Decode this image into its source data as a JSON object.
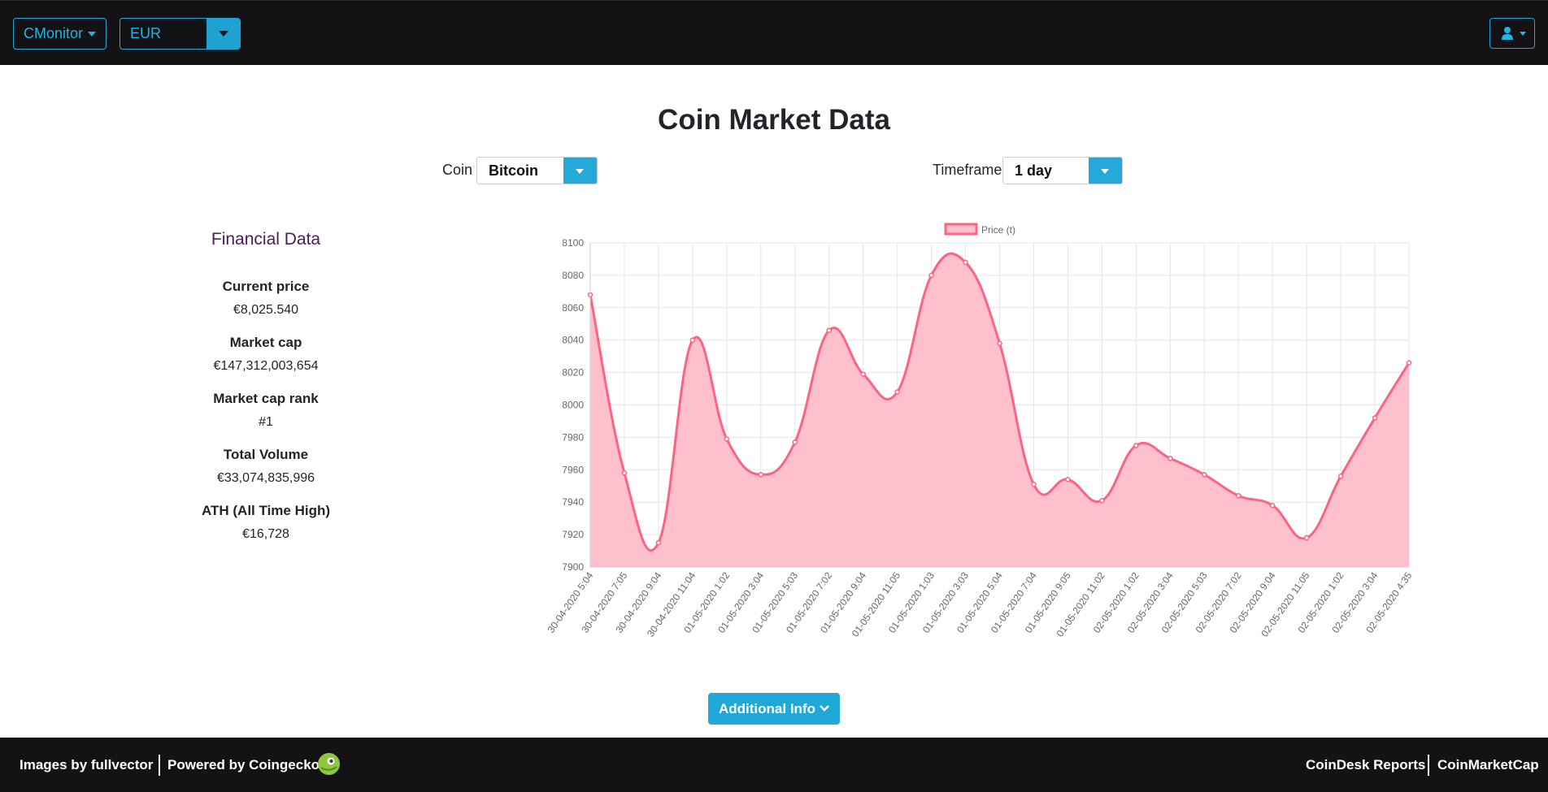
{
  "nav": {
    "brand_label": "CMonitor",
    "currency": "EUR"
  },
  "page": {
    "title": "Coin Market Data"
  },
  "controls": {
    "coin_label": "Coin",
    "coin_value": "Bitcoin",
    "timeframe_label": "Timeframe",
    "timeframe_value": "1 day"
  },
  "financial": {
    "title": "Financial Data",
    "items": [
      {
        "label": "Current price",
        "value": "€8,025.540"
      },
      {
        "label": "Market cap",
        "value": "€147,312,003,654"
      },
      {
        "label": "Market cap rank",
        "value": "#1"
      },
      {
        "label": "Total Volume",
        "value": "€33,074,835,996"
      },
      {
        "label": "ATH (All Time High)",
        "value": "€16,728"
      }
    ]
  },
  "chart_data": {
    "type": "area",
    "legend": "Price (t)",
    "legend_position": "top",
    "series": [
      {
        "name": "Price (t)",
        "color": "#ff6384",
        "fill": "#ffc0cd"
      }
    ],
    "categories": [
      "30-04-2020 5:04",
      "30-04-2020 7:05",
      "30-04-2020 9:04",
      "30-04-2020 11:04",
      "01-05-2020 1:02",
      "01-05-2020 3:04",
      "01-05-2020 5:03",
      "01-05-2020 7:02",
      "01-05-2020 9:04",
      "01-05-2020 11:05",
      "01-05-2020 1:03",
      "01-05-2020 3:03",
      "01-05-2020 5:04",
      "01-05-2020 7:04",
      "01-05-2020 9:05",
      "01-05-2020 11:02",
      "02-05-2020 1:02",
      "02-05-2020 3:04",
      "02-05-2020 5:03",
      "02-05-2020 7:02",
      "02-05-2020 9:04",
      "02-05-2020 11:05",
      "02-05-2020 1:02",
      "02-05-2020 3:04",
      "02-05-2020 4:35"
    ],
    "values": [
      8068,
      7958,
      7915,
      8040,
      7979,
      7957,
      7977,
      8046,
      8019,
      8008,
      8080,
      8088,
      8038,
      7951,
      7954,
      7941,
      7975,
      7967,
      7957,
      7944,
      7938,
      7918,
      7956,
      7992,
      8026
    ],
    "ylim": [
      7900,
      8100
    ],
    "yticks": [
      8100,
      8080,
      8060,
      8040,
      8020,
      8000,
      7980,
      7960,
      7940,
      7920,
      7900
    ],
    "grid": true
  },
  "actions": {
    "additional_info": "Additional Info"
  },
  "footer": {
    "images_by": "Images by fullvector",
    "powered_by": "Powered by Coingecko",
    "coindesk": "CoinDesk Reports",
    "coinmarketcap": "CoinMarketCap"
  }
}
